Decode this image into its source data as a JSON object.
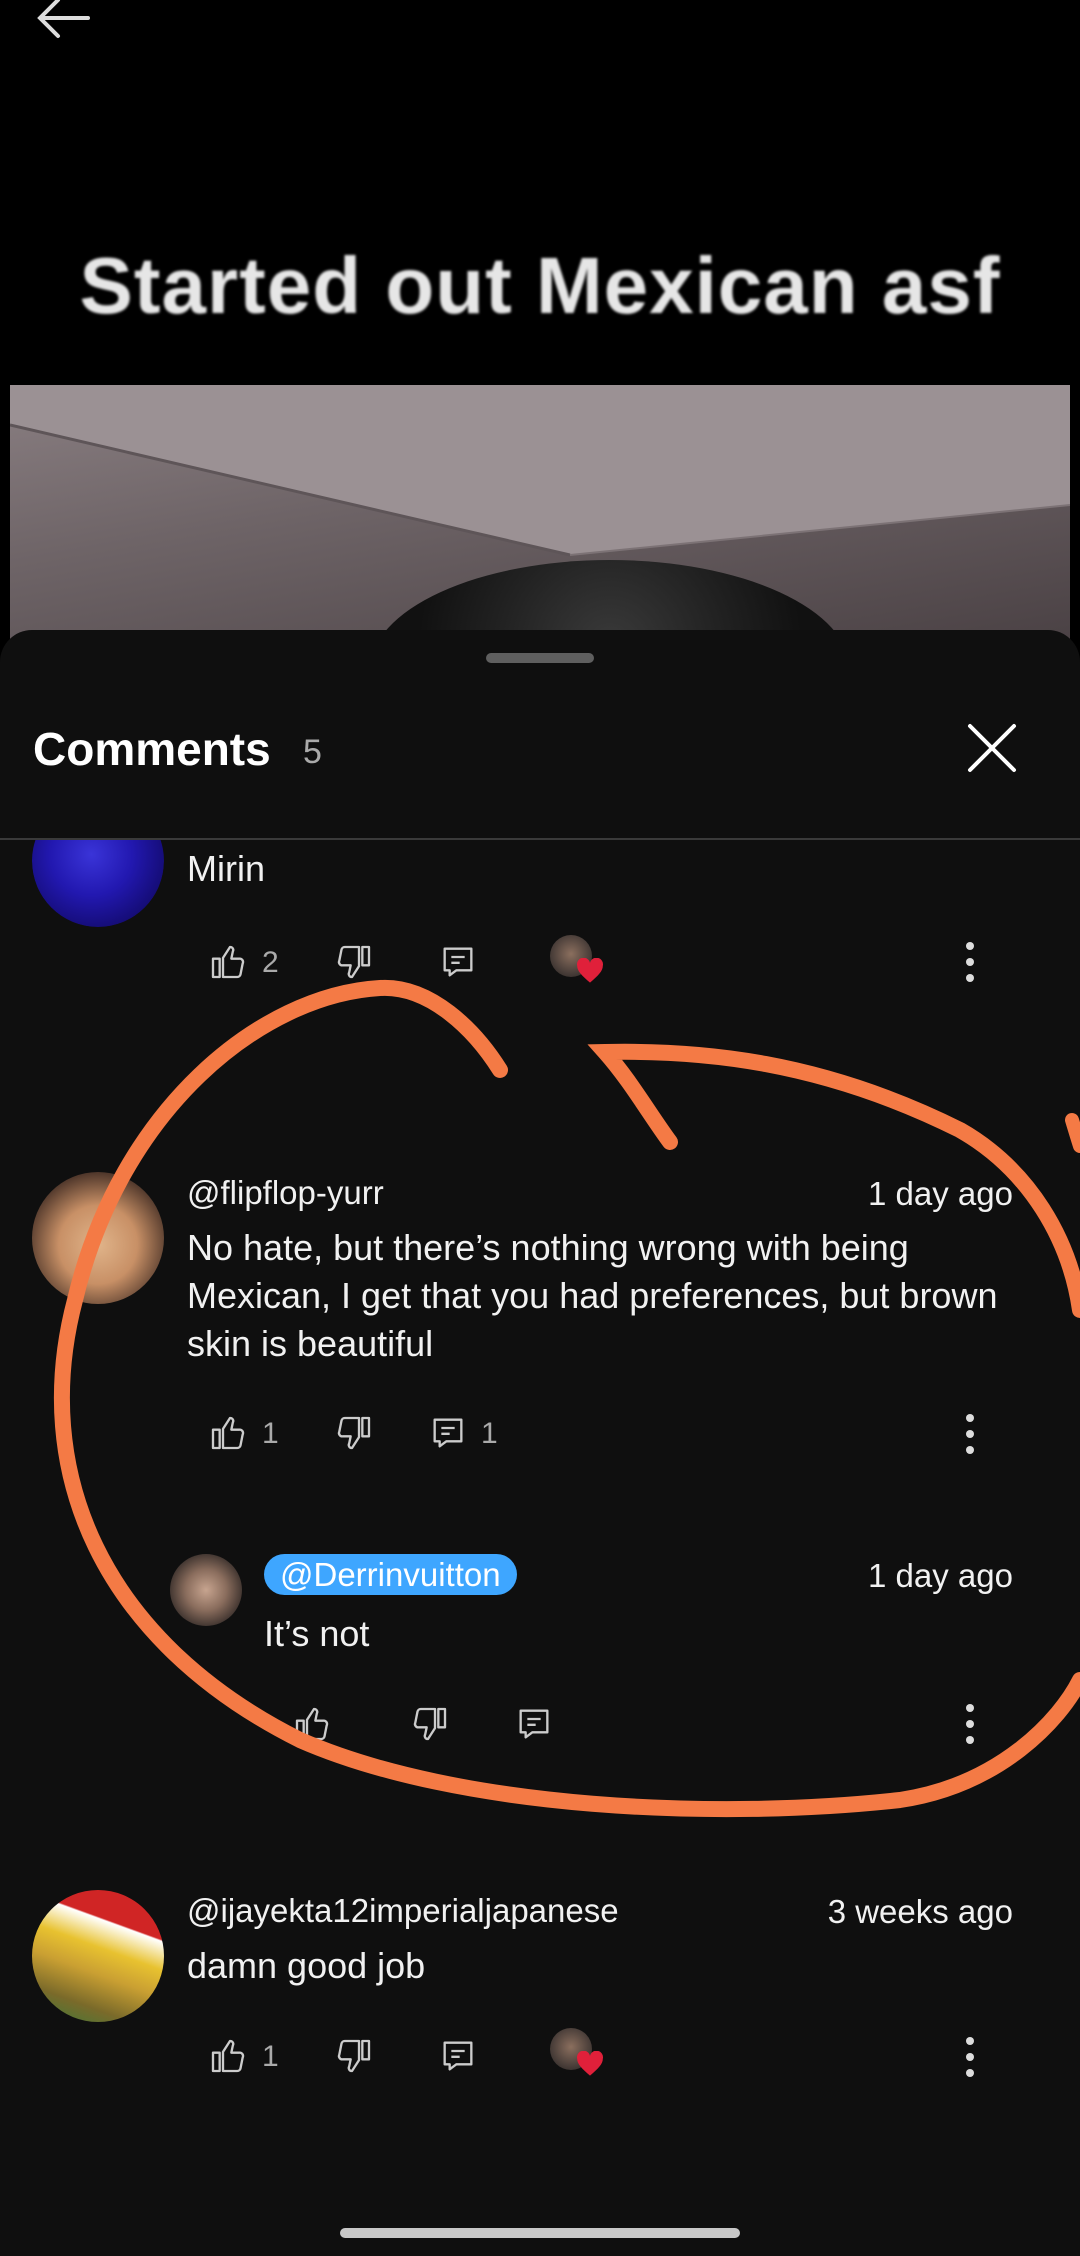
{
  "video": {
    "caption": "Started out Mexican asf"
  },
  "sheet": {
    "title": "Comments",
    "count": "5"
  },
  "comments": [
    {
      "text": "Mirin",
      "likes": "2"
    },
    {
      "username": "@flipflop-yurr",
      "time": "1 day ago",
      "text": "No hate, but there’s nothing wrong with being Mexican, I get that you had preferences,  but brown skin is beautiful",
      "likes": "1",
      "replies": "1"
    },
    {
      "username": "@Derrinvuitton",
      "time": "1 day ago",
      "text": "It’s not"
    },
    {
      "username": "@ijayekta12imperialjapanese",
      "time": "3 weeks ago",
      "text": "damn good job",
      "likes": "1"
    }
  ],
  "colors": {
    "sheet_bg": "#0f0f0f",
    "mention_bg": "#3ea6ff",
    "annotation": "#f47a45",
    "heart": "#e0203a"
  },
  "icons": [
    "back-arrow-icon",
    "close-icon",
    "like-icon",
    "dislike-icon",
    "reply-icon",
    "more-vert-icon",
    "heart-icon"
  ]
}
